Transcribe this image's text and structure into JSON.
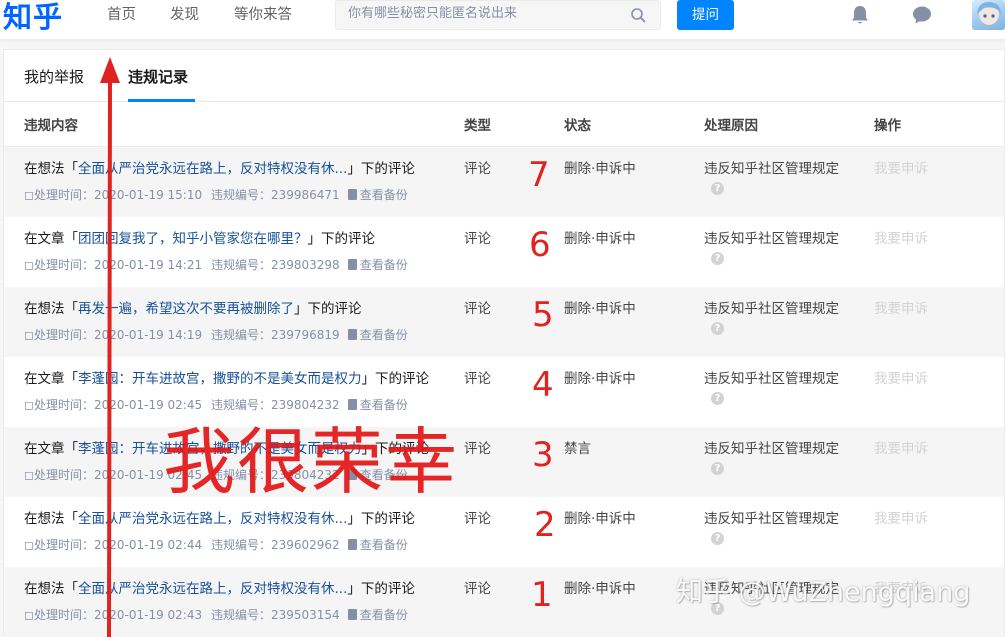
{
  "header": {
    "logo": "知乎",
    "nav": [
      "首页",
      "发现",
      "等你来答"
    ],
    "search_placeholder": "你有哪些秘密只能匿名说出来",
    "ask_label": "提问",
    "icons": [
      "search-icon",
      "bell-icon",
      "chat-icon"
    ],
    "brand_color": "#0084ff"
  },
  "tabs": {
    "report": "我的举报",
    "record": "违规记录"
  },
  "columns": {
    "content": "违规内容",
    "type": "类型",
    "status": "状态",
    "reason": "处理原因",
    "action": "操作"
  },
  "rows": [
    {
      "prefix": "在想法「",
      "link": "全面从严治党永远在路上，反对特权没有休...",
      "suffix": "」下的评论",
      "time_label": "处理时间：",
      "time": "2020-01-19 15:10",
      "id_label": "违规编号：",
      "id": "239986471",
      "backup": "查看备份",
      "type": "评论",
      "status": "删除·申诉中",
      "reason": "违反知乎社区管理规定",
      "action": "我要申诉",
      "annotation": "7"
    },
    {
      "prefix": "在文章「",
      "link": "团团回复我了，知乎小管家您在哪里？",
      "suffix": "」下的评论",
      "time_label": "处理时间：",
      "time": "2020-01-19 14:21",
      "id_label": "违规编号：",
      "id": "239803298",
      "backup": "查看备份",
      "type": "评论",
      "status": "删除·申诉中",
      "reason": "违反知乎社区管理规定",
      "action": "我要申诉",
      "annotation": "6"
    },
    {
      "prefix": "在想法「",
      "link": "再发一遍，希望这次不要再被删除了",
      "suffix": "」下的评论",
      "time_label": "处理时间：",
      "time": "2020-01-19 14:19",
      "id_label": "违规编号：",
      "id": "239796819",
      "backup": "查看备份",
      "type": "评论",
      "status": "删除·申诉中",
      "reason": "违反知乎社区管理规定",
      "action": "我要申诉",
      "annotation": "5"
    },
    {
      "prefix": "在文章「",
      "link": "李蓬园：开车进故宫，撒野的不是美女而是权力",
      "suffix": "」下的评论",
      "time_label": "处理时间：",
      "time": "2020-01-19 02:45",
      "id_label": "违规编号：",
      "id": "239804232",
      "backup": "查看备份",
      "type": "评论",
      "status": "删除·申诉中",
      "reason": "违反知乎社区管理规定",
      "action": "我要申诉",
      "annotation": "4"
    },
    {
      "prefix": "在文章「",
      "link": "李蓬园：开车进故宫，撒野的不是美女而是权力",
      "suffix": "」下的评论",
      "time_label": "处理时间：",
      "time": "2020-01-19 02:45",
      "id_label": "违规编号：",
      "id": "239804232",
      "backup": "查看备份",
      "type": "评论",
      "status": "禁言",
      "reason": "违反知乎社区管理规定",
      "action": "我要申诉",
      "annotation": "3"
    },
    {
      "prefix": "在想法「",
      "link": "全面从严治党永远在路上，反对特权没有休...",
      "suffix": "」下的评论",
      "time_label": "处理时间：",
      "time": "2020-01-19 02:44",
      "id_label": "违规编号：",
      "id": "239602962",
      "backup": "查看备份",
      "type": "评论",
      "status": "删除·申诉中",
      "reason": "违反知乎社区管理规定",
      "action": "我要申诉",
      "annotation": "2"
    },
    {
      "prefix": "在想法「",
      "link": "全面从严治党永远在路上，反对特权没有休...",
      "suffix": "」下的评论",
      "time_label": "处理时间：",
      "time": "2020-01-19 02:43",
      "id_label": "违规编号：",
      "id": "239503154",
      "backup": "查看备份",
      "type": "评论",
      "status": "删除·申诉中",
      "reason": "违反知乎社区管理规定",
      "action": "我要申诉",
      "annotation": "1"
    }
  ],
  "overlay": {
    "text": "我很荣幸",
    "watermark": "知乎 @WuZhengqiang",
    "color": "#e1231f"
  }
}
